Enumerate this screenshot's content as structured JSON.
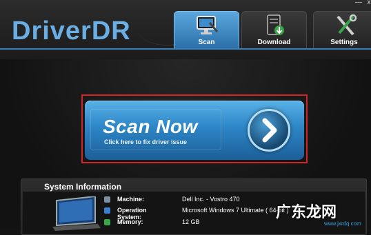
{
  "app": {
    "logo": "DriverDR"
  },
  "tabs": [
    {
      "label": "Scan",
      "icon": "monitor-scan-icon",
      "active": true
    },
    {
      "label": "Download",
      "icon": "download-server-icon",
      "active": false
    },
    {
      "label": "Settings",
      "icon": "tools-icon",
      "active": false
    }
  ],
  "window": {
    "close": "x",
    "minimize": "—"
  },
  "scan_button": {
    "title": "Scan Now",
    "subtitle": "Click here to fix driver issue",
    "icon": "arrow-right-icon"
  },
  "system_info": {
    "title": "System Information",
    "rows": [
      {
        "label": "Machine:",
        "value": "Dell Inc. - Vostro 470",
        "icon": "machine-icon"
      },
      {
        "label": "Operation System:",
        "value": "Microsoft Windows 7 Ultimate  ( 64-bit )",
        "icon": "windows-icon"
      },
      {
        "label": "Memory:",
        "value": "12 GB",
        "icon": "memory-icon"
      }
    ]
  },
  "watermark": {
    "text": "广东龙网",
    "url": "www.jxrdq.com"
  },
  "colors": {
    "accent": "#4ea3dd",
    "highlight_frame": "#d22525",
    "background": "#141414"
  }
}
